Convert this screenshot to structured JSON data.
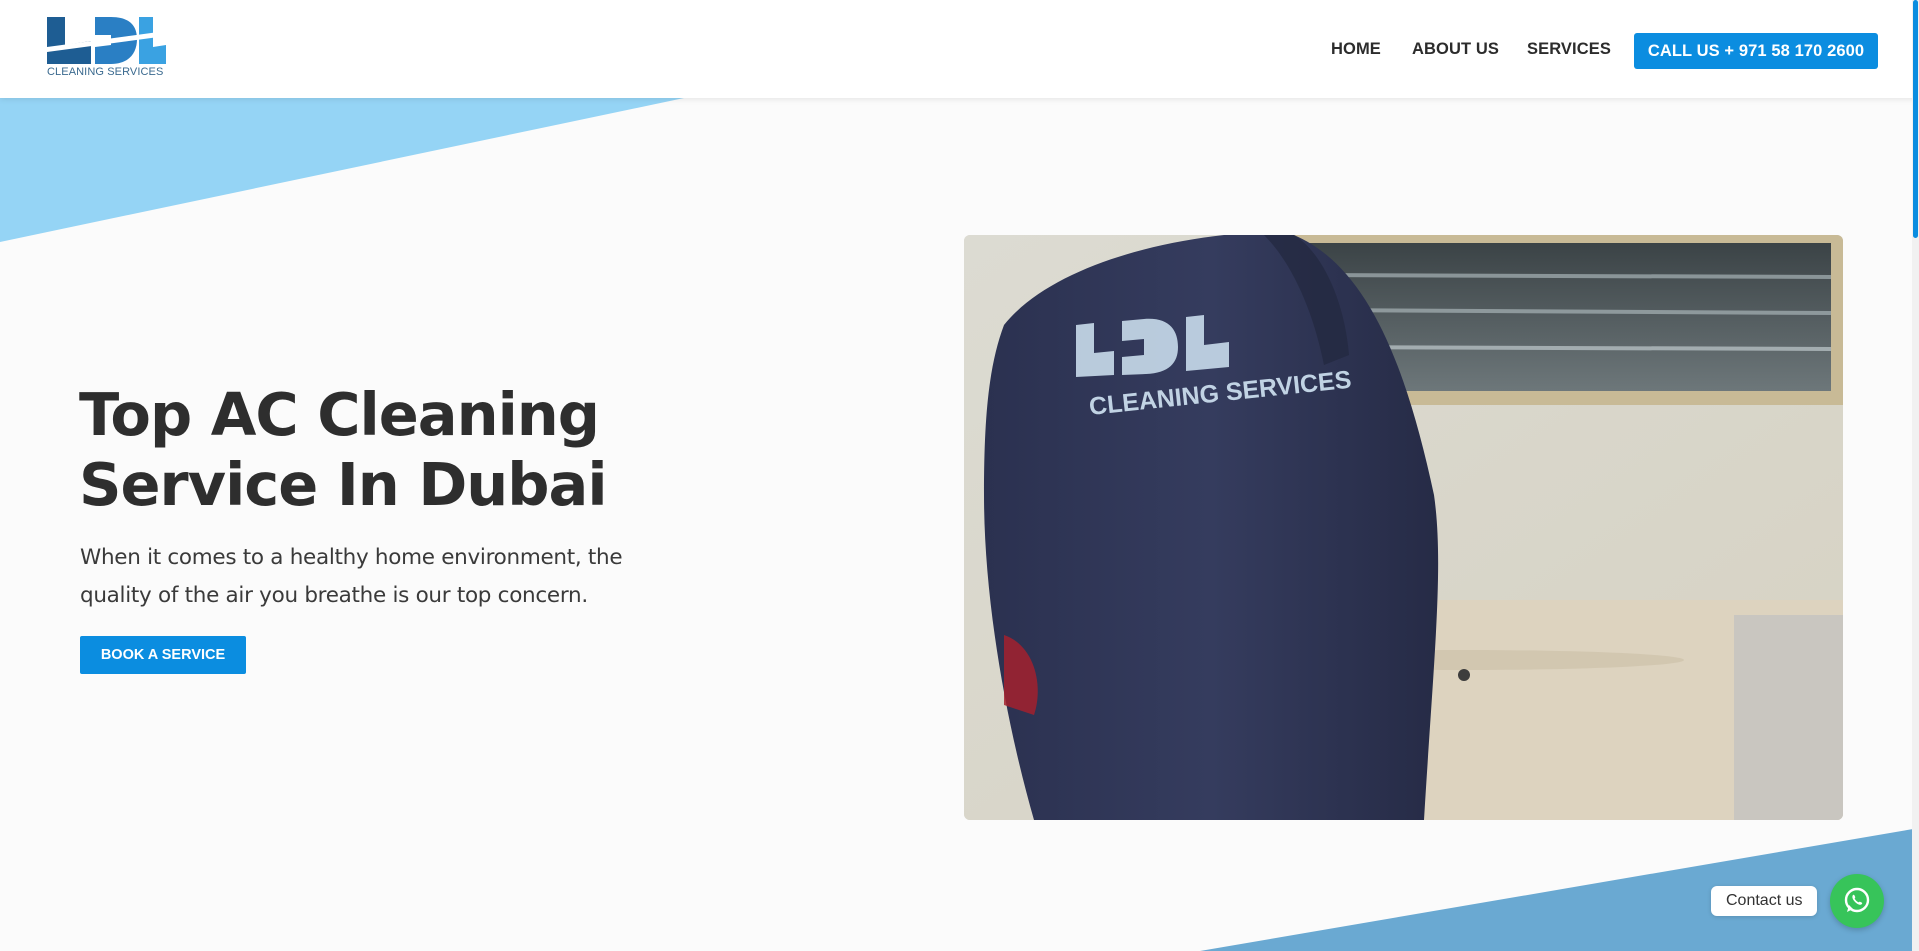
{
  "brand": {
    "tagline": "CLEANING SERVICES"
  },
  "nav": {
    "items": [
      "HOME",
      "ABOUT US",
      "SERVICES"
    ],
    "call_label": "CALL US + 971 58 170 2600"
  },
  "hero": {
    "title_line1": "Top AC Cleaning",
    "title_line2": "Service In Dubai",
    "subtitle_line1": "When it comes to a healthy home environment, the",
    "subtitle_line2": "quality of the air you breathe is our top concern.",
    "cta_label": "BOOK A SERVICE"
  },
  "contact": {
    "label": "Contact us",
    "icon": "whatsapp-icon"
  },
  "colors": {
    "accent": "#0b8de0",
    "light_blue_shape": "#95d4f5",
    "bottom_shape": "#6aa9d2",
    "whatsapp": "#37c45a",
    "text_dark": "#2e2e2e"
  }
}
